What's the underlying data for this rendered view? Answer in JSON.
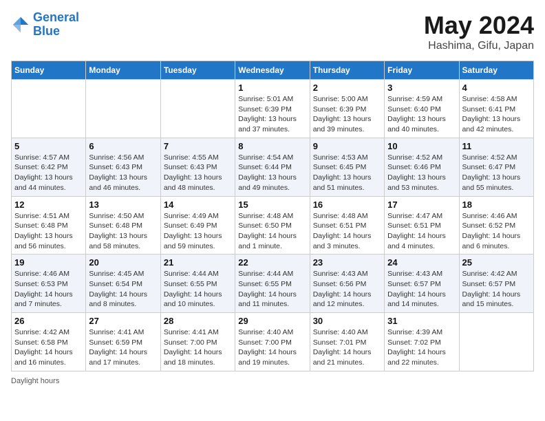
{
  "header": {
    "logo_line1": "General",
    "logo_line2": "Blue",
    "month_title": "May 2024",
    "location": "Hashima, Gifu, Japan"
  },
  "days_of_week": [
    "Sunday",
    "Monday",
    "Tuesday",
    "Wednesday",
    "Thursday",
    "Friday",
    "Saturday"
  ],
  "footer": "Daylight hours",
  "weeks": [
    [
      {
        "day": "",
        "sunrise": "",
        "sunset": "",
        "daylight": ""
      },
      {
        "day": "",
        "sunrise": "",
        "sunset": "",
        "daylight": ""
      },
      {
        "day": "",
        "sunrise": "",
        "sunset": "",
        "daylight": ""
      },
      {
        "day": "1",
        "sunrise": "Sunrise: 5:01 AM",
        "sunset": "Sunset: 6:39 PM",
        "daylight": "Daylight: 13 hours and 37 minutes."
      },
      {
        "day": "2",
        "sunrise": "Sunrise: 5:00 AM",
        "sunset": "Sunset: 6:39 PM",
        "daylight": "Daylight: 13 hours and 39 minutes."
      },
      {
        "day": "3",
        "sunrise": "Sunrise: 4:59 AM",
        "sunset": "Sunset: 6:40 PM",
        "daylight": "Daylight: 13 hours and 40 minutes."
      },
      {
        "day": "4",
        "sunrise": "Sunrise: 4:58 AM",
        "sunset": "Sunset: 6:41 PM",
        "daylight": "Daylight: 13 hours and 42 minutes."
      }
    ],
    [
      {
        "day": "5",
        "sunrise": "Sunrise: 4:57 AM",
        "sunset": "Sunset: 6:42 PM",
        "daylight": "Daylight: 13 hours and 44 minutes."
      },
      {
        "day": "6",
        "sunrise": "Sunrise: 4:56 AM",
        "sunset": "Sunset: 6:43 PM",
        "daylight": "Daylight: 13 hours and 46 minutes."
      },
      {
        "day": "7",
        "sunrise": "Sunrise: 4:55 AM",
        "sunset": "Sunset: 6:43 PM",
        "daylight": "Daylight: 13 hours and 48 minutes."
      },
      {
        "day": "8",
        "sunrise": "Sunrise: 4:54 AM",
        "sunset": "Sunset: 6:44 PM",
        "daylight": "Daylight: 13 hours and 49 minutes."
      },
      {
        "day": "9",
        "sunrise": "Sunrise: 4:53 AM",
        "sunset": "Sunset: 6:45 PM",
        "daylight": "Daylight: 13 hours and 51 minutes."
      },
      {
        "day": "10",
        "sunrise": "Sunrise: 4:52 AM",
        "sunset": "Sunset: 6:46 PM",
        "daylight": "Daylight: 13 hours and 53 minutes."
      },
      {
        "day": "11",
        "sunrise": "Sunrise: 4:52 AM",
        "sunset": "Sunset: 6:47 PM",
        "daylight": "Daylight: 13 hours and 55 minutes."
      }
    ],
    [
      {
        "day": "12",
        "sunrise": "Sunrise: 4:51 AM",
        "sunset": "Sunset: 6:48 PM",
        "daylight": "Daylight: 13 hours and 56 minutes."
      },
      {
        "day": "13",
        "sunrise": "Sunrise: 4:50 AM",
        "sunset": "Sunset: 6:48 PM",
        "daylight": "Daylight: 13 hours and 58 minutes."
      },
      {
        "day": "14",
        "sunrise": "Sunrise: 4:49 AM",
        "sunset": "Sunset: 6:49 PM",
        "daylight": "Daylight: 13 hours and 59 minutes."
      },
      {
        "day": "15",
        "sunrise": "Sunrise: 4:48 AM",
        "sunset": "Sunset: 6:50 PM",
        "daylight": "Daylight: 14 hours and 1 minute."
      },
      {
        "day": "16",
        "sunrise": "Sunrise: 4:48 AM",
        "sunset": "Sunset: 6:51 PM",
        "daylight": "Daylight: 14 hours and 3 minutes."
      },
      {
        "day": "17",
        "sunrise": "Sunrise: 4:47 AM",
        "sunset": "Sunset: 6:51 PM",
        "daylight": "Daylight: 14 hours and 4 minutes."
      },
      {
        "day": "18",
        "sunrise": "Sunrise: 4:46 AM",
        "sunset": "Sunset: 6:52 PM",
        "daylight": "Daylight: 14 hours and 6 minutes."
      }
    ],
    [
      {
        "day": "19",
        "sunrise": "Sunrise: 4:46 AM",
        "sunset": "Sunset: 6:53 PM",
        "daylight": "Daylight: 14 hours and 7 minutes."
      },
      {
        "day": "20",
        "sunrise": "Sunrise: 4:45 AM",
        "sunset": "Sunset: 6:54 PM",
        "daylight": "Daylight: 14 hours and 8 minutes."
      },
      {
        "day": "21",
        "sunrise": "Sunrise: 4:44 AM",
        "sunset": "Sunset: 6:55 PM",
        "daylight": "Daylight: 14 hours and 10 minutes."
      },
      {
        "day": "22",
        "sunrise": "Sunrise: 4:44 AM",
        "sunset": "Sunset: 6:55 PM",
        "daylight": "Daylight: 14 hours and 11 minutes."
      },
      {
        "day": "23",
        "sunrise": "Sunrise: 4:43 AM",
        "sunset": "Sunset: 6:56 PM",
        "daylight": "Daylight: 14 hours and 12 minutes."
      },
      {
        "day": "24",
        "sunrise": "Sunrise: 4:43 AM",
        "sunset": "Sunset: 6:57 PM",
        "daylight": "Daylight: 14 hours and 14 minutes."
      },
      {
        "day": "25",
        "sunrise": "Sunrise: 4:42 AM",
        "sunset": "Sunset: 6:57 PM",
        "daylight": "Daylight: 14 hours and 15 minutes."
      }
    ],
    [
      {
        "day": "26",
        "sunrise": "Sunrise: 4:42 AM",
        "sunset": "Sunset: 6:58 PM",
        "daylight": "Daylight: 14 hours and 16 minutes."
      },
      {
        "day": "27",
        "sunrise": "Sunrise: 4:41 AM",
        "sunset": "Sunset: 6:59 PM",
        "daylight": "Daylight: 14 hours and 17 minutes."
      },
      {
        "day": "28",
        "sunrise": "Sunrise: 4:41 AM",
        "sunset": "Sunset: 7:00 PM",
        "daylight": "Daylight: 14 hours and 18 minutes."
      },
      {
        "day": "29",
        "sunrise": "Sunrise: 4:40 AM",
        "sunset": "Sunset: 7:00 PM",
        "daylight": "Daylight: 14 hours and 19 minutes."
      },
      {
        "day": "30",
        "sunrise": "Sunrise: 4:40 AM",
        "sunset": "Sunset: 7:01 PM",
        "daylight": "Daylight: 14 hours and 21 minutes."
      },
      {
        "day": "31",
        "sunrise": "Sunrise: 4:39 AM",
        "sunset": "Sunset: 7:02 PM",
        "daylight": "Daylight: 14 hours and 22 minutes."
      },
      {
        "day": "",
        "sunrise": "",
        "sunset": "",
        "daylight": ""
      }
    ]
  ]
}
